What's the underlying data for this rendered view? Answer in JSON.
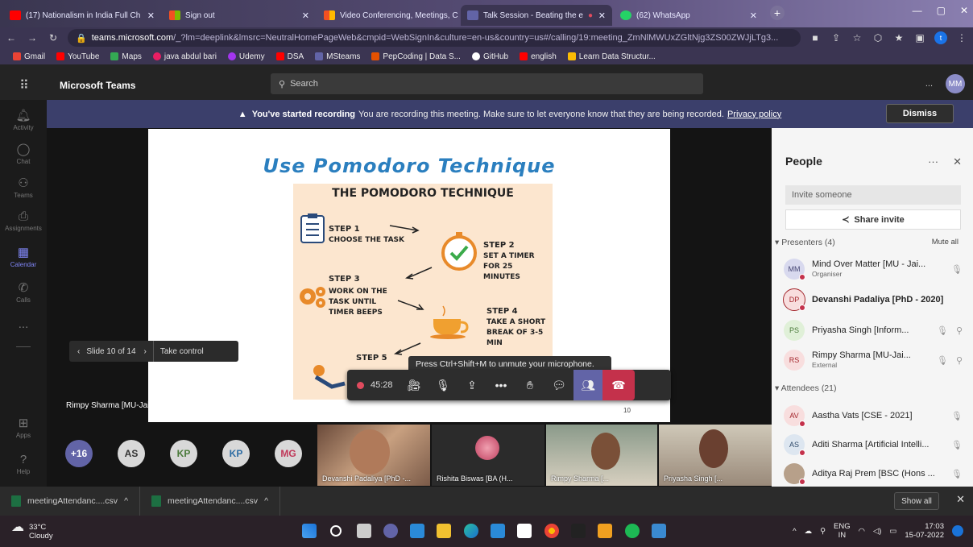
{
  "browser": {
    "tabs": [
      {
        "label": "(17) Nationalism in India Full Ch",
        "icon": "youtube-icon",
        "color": "#ff0000"
      },
      {
        "label": "Sign out",
        "icon": "microsoft-icon",
        "color": "#f25022"
      },
      {
        "label": "Video Conferencing, Meetings, C",
        "icon": "microsoft-icon",
        "color": "#7fba00"
      },
      {
        "label": "Talk Session - Beating the e",
        "icon": "teams-icon",
        "color": "#6264a7"
      },
      {
        "label": "(62) WhatsApp",
        "icon": "whatsapp-icon",
        "color": "#25d366"
      }
    ],
    "url_host": "teams.microsoft.com",
    "url_rest": "/_?lm=deeplink&lmsrc=NeutralHomePageWeb&cmpid=WebSignIn&culture=en-us&country=us#/calling/19:meeting_ZmNlMWUxZGltNjg3ZS00ZWJjLTg3...",
    "bookmarks": [
      {
        "label": "Gmail",
        "color": "#ea4335"
      },
      {
        "label": "YouTube",
        "color": "#ff0000"
      },
      {
        "label": "Maps",
        "color": "#34a853"
      },
      {
        "label": "java abdul bari",
        "color": "#e91e63"
      },
      {
        "label": "Udemy",
        "color": "#a435f0"
      },
      {
        "label": "DSA",
        "color": "#ff0000"
      },
      {
        "label": "MSteams",
        "color": "#6264a7"
      },
      {
        "label": "PepCoding | Data S...",
        "color": "#e65100"
      },
      {
        "label": "GitHub",
        "color": "#ffffff"
      },
      {
        "label": "english",
        "color": "#ff0000"
      },
      {
        "label": "Learn Data Structur...",
        "color": "#fbbc04"
      }
    ]
  },
  "teams": {
    "app_name": "Microsoft Teams",
    "search_placeholder": "Search",
    "more": "...",
    "user_initials": "MM",
    "rail": [
      {
        "label": "Activity",
        "icon": "bell-icon"
      },
      {
        "label": "Chat",
        "icon": "chat-icon"
      },
      {
        "label": "Teams",
        "icon": "teams-icon"
      },
      {
        "label": "Assignments",
        "icon": "assignments-icon"
      },
      {
        "label": "Calendar",
        "icon": "calendar-icon"
      },
      {
        "label": "Calls",
        "icon": "phone-icon"
      },
      {
        "label": "...",
        "icon": "more-icon"
      },
      {
        "label": "Apps",
        "icon": "apps-icon"
      },
      {
        "label": "Help",
        "icon": "help-icon"
      }
    ]
  },
  "banner": {
    "title": "You've started recording",
    "text": "You are recording this meeting. Make sure to let everyone know that they are being recorded.",
    "link": "Privacy policy",
    "dismiss": "Dismiss"
  },
  "slide": {
    "title": "Use Pomodoro Technique",
    "poster_heading": "THE POMODORO TECHNIQUE",
    "steps": [
      {
        "title": "STEP 1",
        "desc": "CHOOSE THE TASK"
      },
      {
        "title": "STEP 2",
        "desc": "SET A TIMER FOR 25 MINUTES"
      },
      {
        "title": "STEP 3",
        "desc": "WORK ON THE TASK UNTIL TIMER BEEPS"
      },
      {
        "title": "STEP 4",
        "desc": "TAKE A SHORT BREAK OF 3-5 MIN"
      },
      {
        "title": "STEP 5",
        "desc": ""
      }
    ],
    "page_number": "10",
    "presenter": "Rimpy Sharma [MU-Jaipur]",
    "slide_counter": "Slide 10 of 14",
    "take_control": "Take control"
  },
  "callbar": {
    "timer": "45:28",
    "tooltip": "Press Ctrl+Shift+M to unmute your microphone."
  },
  "strip": {
    "overflow": "+16",
    "bubbles": [
      {
        "initials": "AS",
        "bg": "#d8d8d8",
        "fg": "#333"
      },
      {
        "initials": "KP",
        "bg": "#d8d8d8",
        "fg": "#4a7a3a"
      },
      {
        "initials": "KP",
        "bg": "#d8d8d8",
        "fg": "#2e6da4"
      },
      {
        "initials": "MG",
        "bg": "#d8d8d8",
        "fg": "#c0395a"
      }
    ],
    "tiles": [
      {
        "name": "Devanshi Padaliya [PhD -..."
      },
      {
        "name": "Rishita Biswas [BA (H..."
      },
      {
        "name": "Rimpy Sharma [..."
      },
      {
        "name": "Priyasha Singh [..."
      }
    ]
  },
  "people": {
    "title": "People",
    "invite_placeholder": "Invite someone",
    "share_invite": "Share invite",
    "presenters_header": "Presenters (4)",
    "mute_all": "Mute all",
    "presenters": [
      {
        "initials": "MM",
        "name": "Mind Over Matter [MU - Jai...",
        "sub": "Organiser",
        "bg": "#d8d9ee",
        "fg": "#464775"
      },
      {
        "initials": "DP",
        "name": "Devanshi Padaliya [PhD - 2020]",
        "sub": "",
        "bg": "#f8dede",
        "fg": "#a4262c"
      },
      {
        "initials": "PS",
        "name": "Priyasha Singh [Inform...",
        "sub": "",
        "bg": "#e0f0d8",
        "fg": "#4a7a3a"
      },
      {
        "initials": "RS",
        "name": "Rimpy Sharma [MU-Jai...",
        "sub": "External",
        "bg": "#f8dede",
        "fg": "#a4262c"
      }
    ],
    "attendees_header": "Attendees (21)",
    "attendees": [
      {
        "initials": "AV",
        "name": "Aastha Vats [CSE - 2021]",
        "bg": "#f8dede",
        "fg": "#a4262c"
      },
      {
        "initials": "AS",
        "name": "Aditi Sharma [Artificial Intelli...",
        "bg": "#dde6f0",
        "fg": "#2e4a6a"
      },
      {
        "initials": "",
        "name": "Aditya Raj Prem [BSC (Hons ...",
        "bg": "#b7a08a",
        "fg": "#333"
      }
    ]
  },
  "downloads": {
    "files": [
      "meetingAttendanc....csv",
      "meetingAttendanc....csv"
    ],
    "show_all": "Show all"
  },
  "taskbar": {
    "temp": "33°C",
    "weather": "Cloudy",
    "lang": "ENG",
    "region": "IN",
    "time": "17:03",
    "date": "15-07-2022"
  }
}
